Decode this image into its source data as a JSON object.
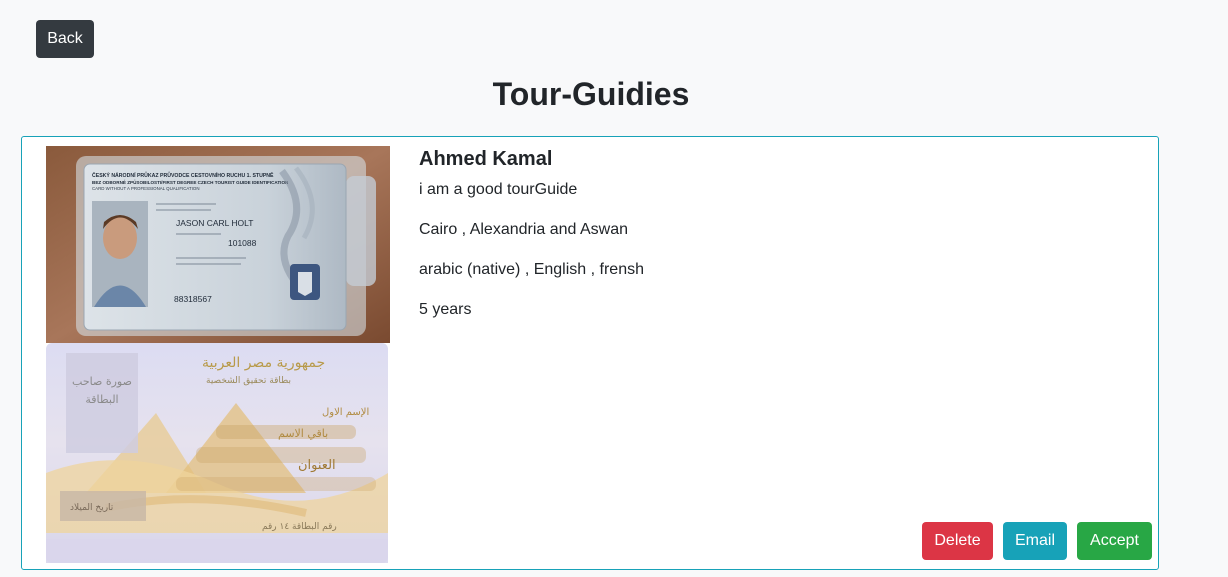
{
  "header": {
    "back_label": "Back",
    "title": "Tour-Guidies"
  },
  "guide": {
    "name": "Ahmed Kamal",
    "bio": "i am a good tourGuide",
    "cities": "Cairo , Alexandria and Aswan",
    "languages": "arabic (native) , English , frensh",
    "experience": "5 years",
    "id_front": {
      "header_line1": "ČESKÝ NÁRODNÍ PRŮKAZ PRŮVODCE CESTOVNÍHO RUCHU 1. STUPNĚ",
      "header_line2": "BEZ ODBORNÉ ZPŮSOBILOSTI/FIRST DEGREE CZECH TOURIST GUIDE IDENTIFICATION",
      "header_line3": "CARD WITHOUT A PROFESSIONAL QUALIFICATION",
      "holder_name": "JASON CARL HOLT",
      "card_number": "101088",
      "id_number": "88318567"
    },
    "id_back": {
      "title": "جمهورية مصر العربية",
      "subtitle": "بطاقة تحقيق الشخصية",
      "photo_label": "صورة صاحب البطاقة",
      "first_name_label": "الإسم الاول",
      "rest_name_label": "باقي الاسم",
      "address_label": "العنوان",
      "birth_date_label": "تاريخ الميلاد",
      "card_number_label": "رقم البطاقة ١٤ رقم"
    }
  },
  "actions": {
    "delete_label": "Delete",
    "email_label": "Email",
    "accept_label": "Accept"
  },
  "colors": {
    "back": "#343a40",
    "delete": "#dc3545",
    "email": "#17a2b8",
    "accept": "#28a745",
    "card_border": "#17a2b8"
  }
}
